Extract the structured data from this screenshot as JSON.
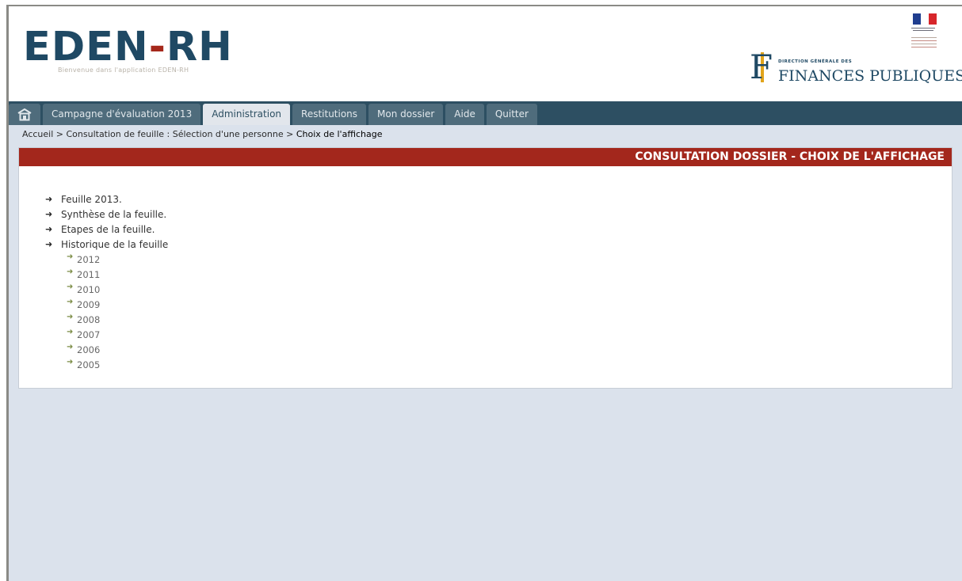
{
  "header": {
    "logo_text_left": "EDEN",
    "logo_text_dash": "-",
    "logo_text_right": "RH",
    "tagline": "Bienvenue dans l'application EDEN-RH",
    "dgfip_line1": "DIRECTION GÉNÉRALE DES",
    "dgfip_line2": "FINANCES PUBLIQUES"
  },
  "nav": {
    "home_icon": "home-icon",
    "tabs": [
      {
        "label": "Campagne d'évaluation 2013"
      },
      {
        "label": "Administration"
      },
      {
        "label": "Restitutions"
      },
      {
        "label": "Mon dossier"
      },
      {
        "label": "Aide"
      },
      {
        "label": "Quitter"
      }
    ],
    "active_tab": "Administration"
  },
  "breadcrumb": {
    "path": "Accueil > Consultation de feuille : Sélection d'une personne > ",
    "current": "Choix de l'affichage"
  },
  "panel": {
    "title": "CONSULTATION DOSSIER - CHOIX DE L'AFFICHAGE",
    "items": [
      {
        "label": "Feuille 2013."
      },
      {
        "label": "Synthèse de la feuille."
      },
      {
        "label": "Etapes de la feuille."
      },
      {
        "label": "Historique de la feuille"
      }
    ],
    "history_years": [
      "2012",
      "2011",
      "2010",
      "2009",
      "2008",
      "2007",
      "2006",
      "2005"
    ]
  },
  "colors": {
    "navbar": "#2d4f62",
    "tab": "#4f6c7c",
    "active_tab": "#e2e6ec",
    "title_bar": "#a3271c",
    "background": "#dbe2ec"
  }
}
